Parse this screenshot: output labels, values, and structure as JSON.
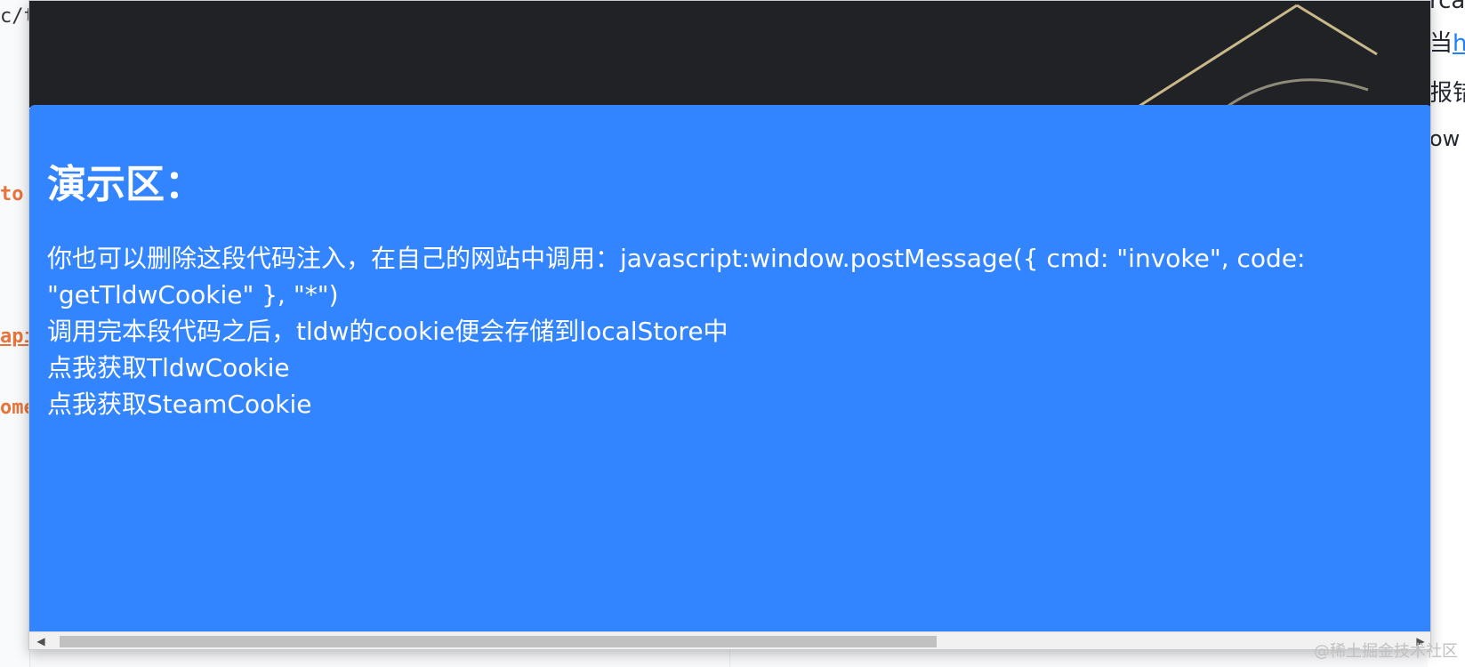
{
  "background_left": {
    "fragments": [
      "c/t",
      "to",
      "api",
      "ome"
    ]
  },
  "background_right": {
    "fragment_0": "rca",
    "fragment_1_prefix": "当",
    "fragment_1_link": "h",
    "fragment_2": "报错",
    "fragment_3": "ow"
  },
  "demo": {
    "title": "演示区：",
    "line_1": "你也可以删除这段代码注入，在自己的网站中调用：javascript:window.postMessage({ cmd: \"invoke\", code: \"getTldwCookie\" }, \"*\")",
    "line_2": "调用完本段代码之后，tldw的cookie便会存储到localStore中",
    "link_tldw": "点我获取TldwCookie",
    "link_steam": "点我获取SteamCookie"
  },
  "watermark": "@稀土掘金技术社区",
  "colors": {
    "panel_blue": "#3384ff",
    "banner_dark": "#212226",
    "code_orange": "#e8743b"
  }
}
